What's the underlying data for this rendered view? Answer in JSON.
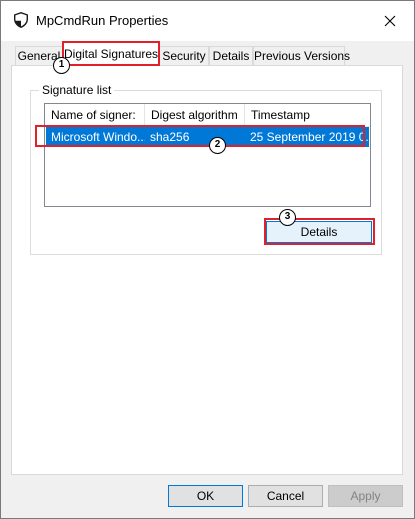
{
  "window": {
    "title": "MpCmdRun Properties",
    "close_icon": "close-icon"
  },
  "tabs": [
    {
      "label": "General",
      "active": false
    },
    {
      "label": "Digital Signatures",
      "active": true
    },
    {
      "label": "Security",
      "active": false
    },
    {
      "label": "Details",
      "active": false
    },
    {
      "label": "Previous Versions",
      "active": false
    }
  ],
  "signature_list": {
    "group_label": "Signature list",
    "columns": [
      "Name of signer:",
      "Digest algorithm",
      "Timestamp"
    ],
    "rows": [
      {
        "signer": "Microsoft Windo...",
        "digest": "sha256",
        "timestamp": "25 September 2019 0...",
        "selected": true
      }
    ],
    "details_button": "Details"
  },
  "callouts": [
    "1",
    "2",
    "3"
  ],
  "footer": {
    "ok": "OK",
    "cancel": "Cancel",
    "apply": "Apply"
  },
  "colors": {
    "selection": "#0078d7",
    "annotation": "#e0202a"
  }
}
